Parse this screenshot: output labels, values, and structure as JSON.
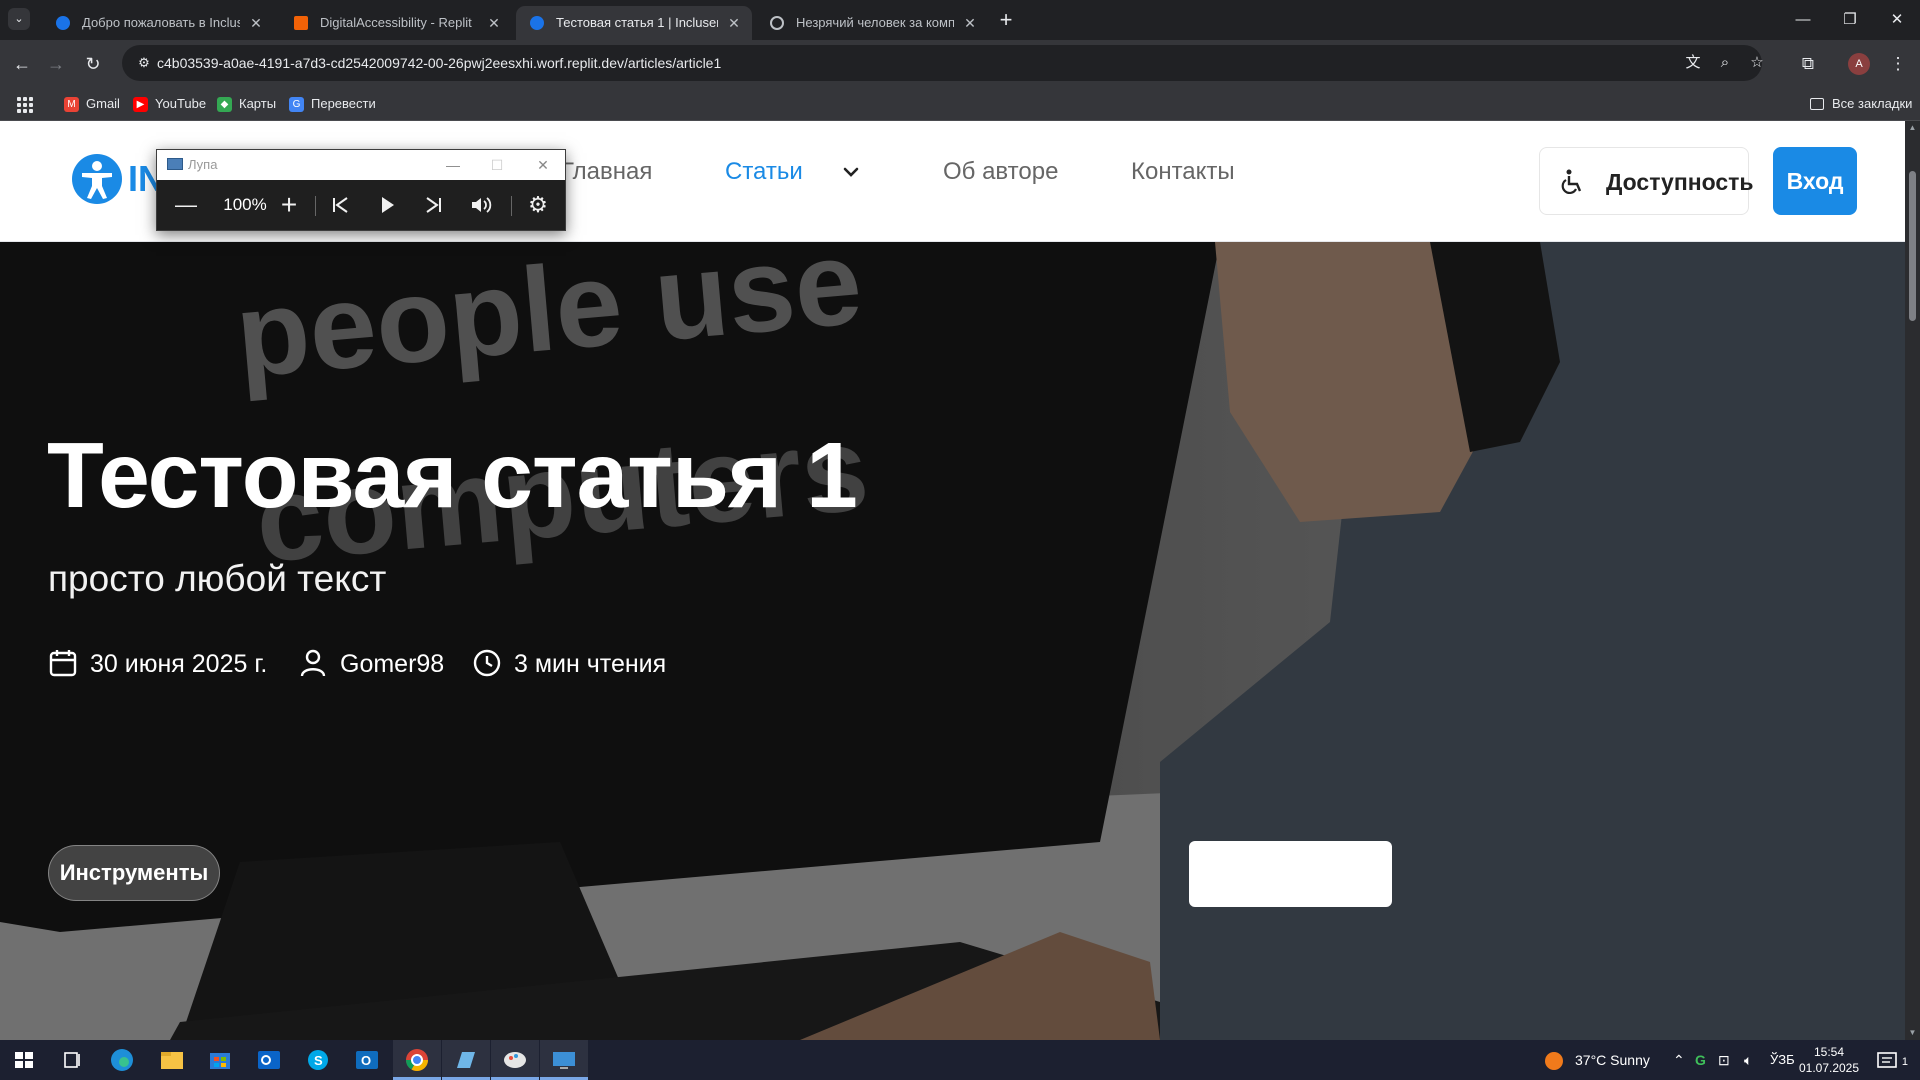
{
  "browser": {
    "tabs": [
      {
        "label": "Добро пожаловать в IncluserI",
        "active": false,
        "favicon": "incluser-icon"
      },
      {
        "label": "DigitalAccessibility - Replit",
        "active": false,
        "favicon": "replit-icon"
      },
      {
        "label": "Тестовая статья 1 | Incluser",
        "active": true,
        "favicon": "incluser-icon"
      },
      {
        "label": "Незрячий человек за компью",
        "active": false,
        "favicon": "globe-icon"
      }
    ],
    "new_tab": "+",
    "url": "c4b03539-a0ae-4191-a7d3-cd2542009742-00-26pwj2eesxhi.worf.replit.dev/articles/article1",
    "bookmarks": [
      {
        "label": "Gmail",
        "color": "#ea4335"
      },
      {
        "label": "YouTube",
        "color": "#ff0000"
      },
      {
        "label": "Карты",
        "color": "#34a853"
      },
      {
        "label": "Перевести",
        "color": "#4285f4"
      }
    ],
    "all_bookmarks": "Все закладки",
    "profile_initial": "A"
  },
  "site": {
    "logo_text": "INC",
    "nav": {
      "home": "Главная",
      "articles": "Статьи",
      "about": "Об авторе",
      "contacts": "Контакты"
    },
    "accessibility_button": "Доступность",
    "login_button": "Вход",
    "accent_color": "#1a8ae5"
  },
  "hero": {
    "title": "Тестовая статья 1",
    "subtitle": "просто любой текст",
    "date": "30 июня 2025 г.",
    "author": "Gomer98",
    "read_time": "3 мин чтения",
    "tools_button": "Инструменты",
    "bg_text_1": "people use",
    "bg_text_2": "computers"
  },
  "magnifier": {
    "title": "Лупа",
    "zoom": "100%"
  },
  "taskbar": {
    "weather": "37°C  Sunny",
    "language": "ЎЗБ",
    "time": "15:54",
    "date": "01.07.2025",
    "notification_count": "1"
  }
}
